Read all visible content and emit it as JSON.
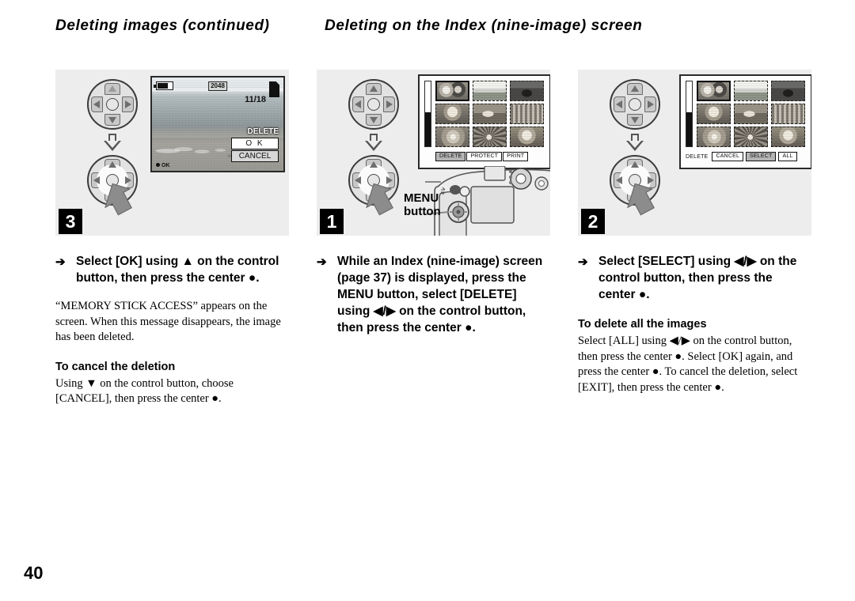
{
  "page": {
    "number": "40"
  },
  "headers": {
    "left": "Deleting images (continued)",
    "right": "Deleting on the Index (nine-image) screen"
  },
  "columns": [
    {
      "id": "col-1",
      "step_number": "3",
      "illustration": {
        "type": "single-image-lcd",
        "lcd": {
          "image_size": "2048",
          "frame_counter": "11/18",
          "menu_title": "DELETE",
          "option_ok": "O K",
          "option_cancel": "CANCEL",
          "ok_hint": "OK",
          "battery_icon": "battery-icon",
          "memory_stick_icon": "memory-stick-icon"
        }
      },
      "step_text": {
        "arrow": "➔",
        "text": "Select [OK] using ▲ on the control button, then press the center ●."
      },
      "body_text": "“MEMORY STICK ACCESS” appears on the screen. When this message disappears, the image has been deleted.",
      "sub_head": "To cancel the deletion",
      "sub_body": "Using ▼ on the control button, choose [CANCEL], then press the center ●."
    },
    {
      "id": "col-2",
      "step_number": "1",
      "illustration": {
        "type": "index-lcd-with-camera",
        "menu_items": [
          "DELETE",
          "PROTECT",
          "PRINT"
        ],
        "menu_highlighted": "DELETE",
        "callout_label_line1": "MENU",
        "callout_label_line2": "button",
        "thumbnails": [
          "couple-photo",
          "landscape-photo",
          "arch-photo",
          "girl-photo",
          "dog-photo",
          "crowd-photo",
          "rose-photo",
          "flower-photo",
          "smiling-woman-photo"
        ],
        "selected_thumbnail_index": 0
      },
      "step_text": {
        "arrow": "➔",
        "text": "While an Index (nine-image) screen (page 37) is displayed, press the MENU button, select [DELETE] using ◀/▶ on the control button, then press the center ●."
      },
      "body_text": "",
      "sub_head": "",
      "sub_body": ""
    },
    {
      "id": "col-3",
      "step_number": "2",
      "illustration": {
        "type": "index-lcd",
        "menu_label": "DELETE",
        "menu_items": [
          "CANCEL",
          "SELECT",
          "ALL"
        ],
        "menu_highlighted": "SELECT",
        "thumbnails": [
          "couple-photo",
          "landscape-photo",
          "arch-photo",
          "girl-photo",
          "dog-photo",
          "crowd-photo",
          "rose-photo",
          "flower-photo",
          "smiling-woman-photo"
        ],
        "selected_thumbnail_index": 0
      },
      "step_text": {
        "arrow": "➔",
        "text": "Select [SELECT] using ◀/▶ on the control button, then press the center ●."
      },
      "body_text": "",
      "sub_head": "To delete all the images",
      "sub_body": "Select [ALL] using ◀/▶ on the control button, then press the center ●.  Select [OK] again, and press the center ●. To cancel the deletion, select [EXIT], then press the center ●."
    }
  ],
  "colors": {
    "panel_background": "#ededed",
    "badge_background": "#000000",
    "badge_text": "#ffffff",
    "text": "#000000"
  }
}
